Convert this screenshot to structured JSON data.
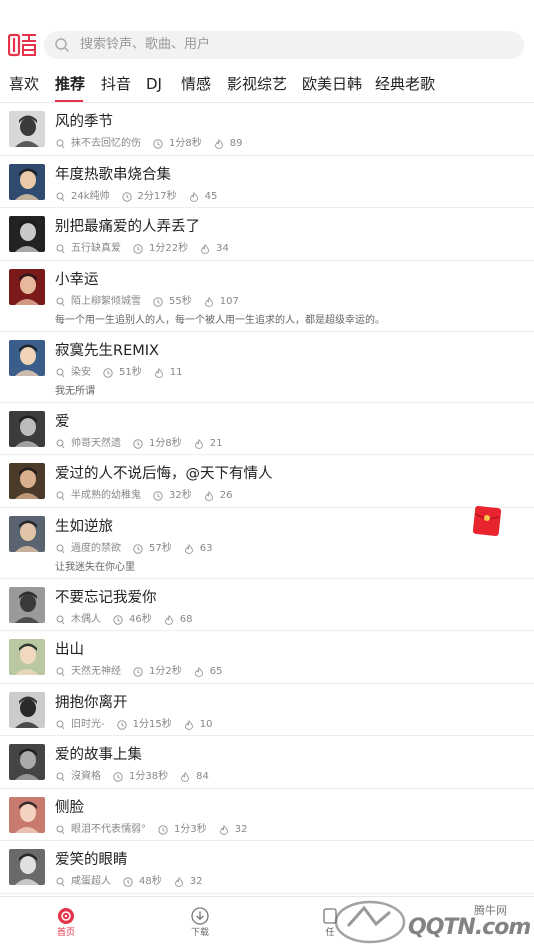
{
  "search": {
    "placeholder": "搜索铃声、歌曲、用户"
  },
  "tabs": [
    "喜欢",
    "推荐",
    "抖音",
    "DJ",
    "情感",
    "影视综艺",
    "欧美日韩",
    "经典老歌"
  ],
  "active_tab": "推荐",
  "accent_color": "#e5334a",
  "songs": [
    {
      "title": "风的季节",
      "author": "抹不去回忆的伤",
      "duration": "1分8秒",
      "count": "89",
      "desc": ""
    },
    {
      "title": "年度热歌串烧合集",
      "author": "24k纯帅",
      "duration": "2分17秒",
      "count": "45",
      "desc": ""
    },
    {
      "title": "别把最痛爱的人弄丢了",
      "author": "五行缺真爱",
      "duration": "1分22秒",
      "count": "34",
      "desc": ""
    },
    {
      "title": "小幸运",
      "author": "陌上柳絮倾城雪",
      "duration": "55秒",
      "count": "107",
      "desc": "每一个用一生追别人的人，每一个被人用一生追求的人，都是超级幸运的。"
    },
    {
      "title": "寂寞先生REMIX",
      "author": "染安",
      "duration": "51秒",
      "count": "11",
      "desc": "我无所谓"
    },
    {
      "title": "爱",
      "author": "帅哥天然遗",
      "duration": "1分8秒",
      "count": "21",
      "desc": ""
    },
    {
      "title": "爱过的人不说后悔，@天下有情人",
      "author": "半成熟的幼稚鬼",
      "duration": "32秒",
      "count": "26",
      "desc": ""
    },
    {
      "title": "生如逆旅",
      "author": "過度的禁欲",
      "duration": "57秒",
      "count": "63",
      "desc": "让我迷失在你心里"
    },
    {
      "title": "不要忘记我爱你",
      "author": "木偶人",
      "duration": "46秒",
      "count": "68",
      "desc": ""
    },
    {
      "title": "出山",
      "author": "天然无神经",
      "duration": "1分2秒",
      "count": "65",
      "desc": ""
    },
    {
      "title": "拥抱你离开",
      "author": "旧时光-",
      "duration": "1分15秒",
      "count": "10",
      "desc": ""
    },
    {
      "title": "爱的故事上集",
      "author": "沒資格",
      "duration": "1分38秒",
      "count": "84",
      "desc": ""
    },
    {
      "title": "侧脸",
      "author": "眼泪不代表懦弱°",
      "duration": "1分3秒",
      "count": "32",
      "desc": ""
    },
    {
      "title": "爱笑的眼睛",
      "author": "咸蛋超人",
      "duration": "48秒",
      "count": "32",
      "desc": ""
    }
  ],
  "bottom_nav": [
    {
      "label": "首页",
      "icon": "home-disc-icon"
    },
    {
      "label": "下载",
      "icon": "download-icon"
    },
    {
      "label": "任",
      "icon": "task-icon"
    }
  ],
  "watermark": {
    "text": "QQTN.com",
    "small": "腾牛网"
  }
}
